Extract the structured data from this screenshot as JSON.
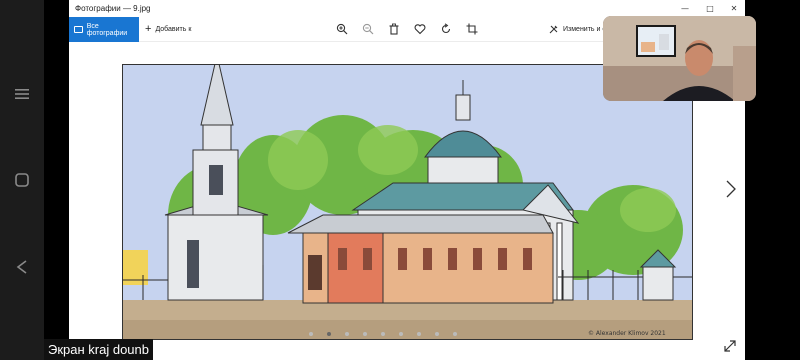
{
  "window": {
    "title": "Фотографии — 9.jpg"
  },
  "toolbar": {
    "all_photos": "Все фотографии",
    "add_label": "Добавить к",
    "edit_label": "Изменить и с"
  },
  "icons": [
    "zoom-in-icon",
    "zoom-out-icon",
    "delete-icon",
    "heart-icon",
    "rotate-icon",
    "crop-icon",
    "edit-icon",
    "next-icon",
    "expand-icon"
  ],
  "image": {
    "signature": "© Alexander Klimov 2021"
  },
  "carousel": {
    "dots_total": 9,
    "active_index": 1
  },
  "caption": {
    "text": "Экран kraj dounb"
  },
  "colors": {
    "accent": "#1976d2",
    "sky": "#c6d3ef",
    "wall": "#e8b48a",
    "dome": "#4f8c97"
  }
}
